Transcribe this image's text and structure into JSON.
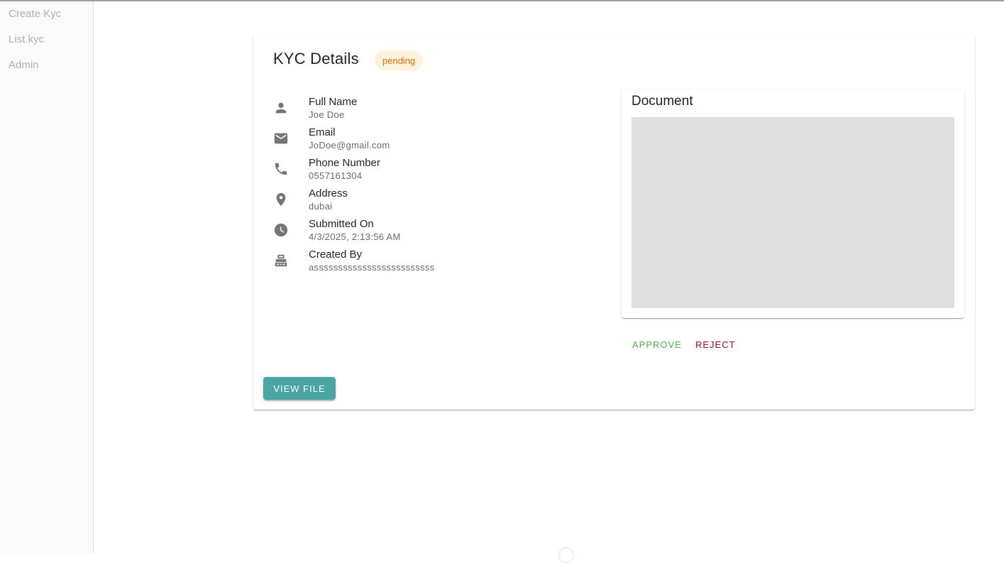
{
  "sidebar": {
    "items": [
      {
        "label": "Create Kyc"
      },
      {
        "label": "List kyc"
      },
      {
        "label": "Admin"
      }
    ]
  },
  "kyc": {
    "title": "KYC Details",
    "status": "pending",
    "fields": [
      {
        "icon": "person-icon",
        "label": "Full Name",
        "value": "Joe Doe"
      },
      {
        "icon": "email-icon",
        "label": "Email",
        "value": "JoDoe@gmail.com"
      },
      {
        "icon": "phone-icon",
        "label": "Phone Number",
        "value": "0557161304"
      },
      {
        "icon": "location-icon",
        "label": "Address",
        "value": "dubai"
      },
      {
        "icon": "clock-icon",
        "label": "Submitted On",
        "value": "4/3/2025, 2:13:56 AM"
      },
      {
        "icon": "badge-icon",
        "label": "Created By",
        "value": "asssssssssssssssssssssssss"
      }
    ],
    "document": {
      "title": "Document"
    },
    "actions": {
      "approve_label": "APPROVE",
      "reject_label": "REJECT",
      "view_file_label": "VIEW FILE"
    }
  },
  "colors": {
    "status_bg": "#fff3e0",
    "status_text": "#ed6c02",
    "approve": "#4caf50",
    "reject": "#b00020",
    "view_button": "#4aa5a3"
  }
}
